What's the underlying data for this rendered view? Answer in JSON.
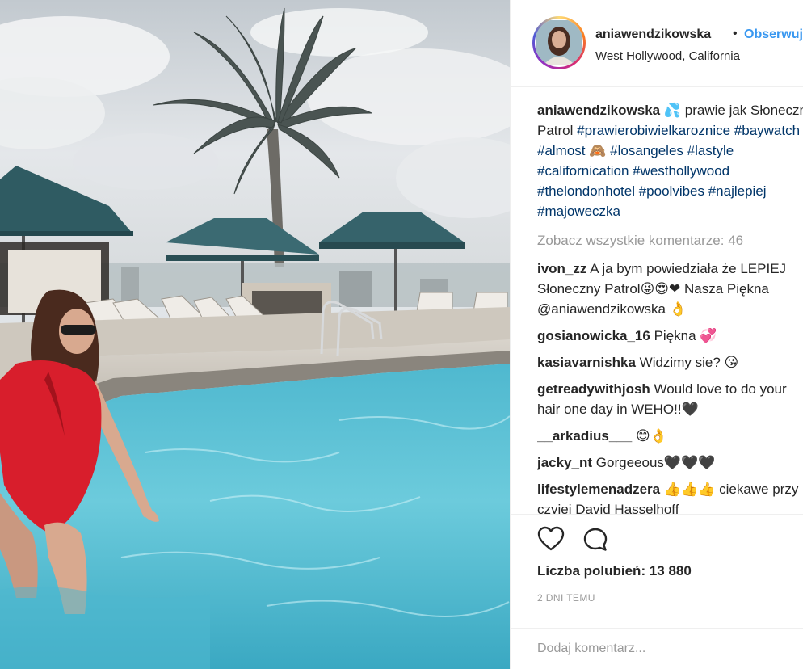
{
  "header": {
    "username": "aniawendzikowska",
    "separator": "•",
    "follow_label": "Obserwuj",
    "location": "West Hollywood, California"
  },
  "caption": {
    "username": "aniawendzikowska",
    "lines": [
      {
        "text": "prawie jak Słoneczny",
        "prefix_emoji": "💦"
      },
      {
        "text": "Patrol ",
        "hashtag": "#prawierobiwielkaroznice #baywatch"
      },
      {
        "hashtag": "#almost",
        "emoji": "🙈",
        "rest": " #losangeles #lastyle"
      },
      {
        "hashtag": "#californication #westhollywood"
      },
      {
        "hashtag": "#thelondonhotel #poolvibes #najlepiej"
      },
      {
        "hashtag": "#majoweczka"
      }
    ]
  },
  "view_all_comments": "Zobacz wszystkie komentarze: 46",
  "comments": [
    {
      "username": "ivon_zz",
      "text": "A ja bym powiedziała że LEPIEJ",
      "line2": "Słoneczny Patrol😜😍❤ Nasza Piękna",
      "line3": "@aniawendzikowska 👌"
    },
    {
      "username": "gosianowicka_16",
      "text": "Piękna 💞"
    },
    {
      "username": "kasiavarnishka",
      "text": "Widzimy sie? 😘"
    },
    {
      "username": "getreadywithjosh",
      "text": "Would love to do your",
      "line2": "hair one day in WEHO!!🖤"
    },
    {
      "username": "__arkadius___",
      "text": "😊👌"
    },
    {
      "username": "jacky_nt",
      "text": "Gorgeeous🖤🖤🖤"
    },
    {
      "username": "lifestylemenadzera",
      "text": "👍👍👍 ciekawe przy",
      "line2": "czyjej David Hasselhoff"
    }
  ],
  "actions": {
    "like_icon": "heart-outline-icon",
    "comment_icon": "speech-bubble-icon",
    "likes_label": "Liczba polubień: 13 880",
    "time_label": "2 DNI TEMU",
    "add_comment_placeholder": "Dodaj komentarz..."
  },
  "colors": {
    "link_blue": "#3897f0",
    "hashtag": "#003569",
    "muted": "#999999",
    "pool_water": "#5fc3d6",
    "swimsuit": "#d81e2c"
  }
}
